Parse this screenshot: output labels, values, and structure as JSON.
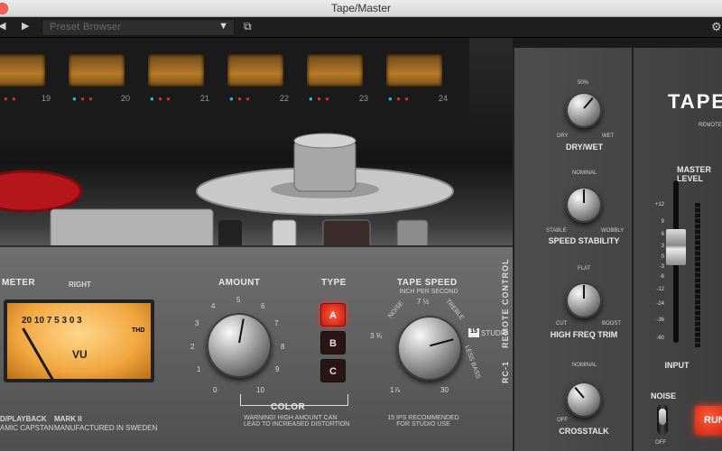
{
  "window": {
    "title": "Tape/Master"
  },
  "toolbar": {
    "preset_placeholder": "Preset Browser",
    "prev_icon": "play-reverse",
    "next_icon": "play",
    "dropdown_icon": "triangle-down",
    "window_icon": "copy-window",
    "settings_icon": "gear"
  },
  "channels": [
    "19",
    "20",
    "21",
    "22",
    "23",
    "24"
  ],
  "plugin": {
    "meter_label": "METER",
    "right_label": "RIGHT",
    "vu_scale": "20 10 7 5 3   0   3",
    "vu_text": "VU",
    "thd": "THD",
    "record_label": "D/PLAYBACK",
    "capstan_label": "AMIC CAPSTAN",
    "model": "MARK II",
    "made_in": "MANUFACTURED IN SWEDEN",
    "amount": {
      "label": "AMOUNT",
      "ticks": [
        "0",
        "1",
        "2",
        "3",
        "4",
        "5",
        "6",
        "7",
        "8",
        "9",
        "10"
      ]
    },
    "color_label": "COLOR",
    "warning": "WARNING! HIGH AMOUNT CAN\nLEAD TO INCREASED DISTORTION",
    "type": {
      "label": "TYPE",
      "options": [
        "A",
        "B",
        "C"
      ],
      "selected": "A"
    },
    "tape_speed": {
      "label": "TAPE SPEED",
      "sublabel": "INCH PER SECOND",
      "positions": [
        "3 ¾",
        "7 ½",
        "1⅞",
        "30"
      ],
      "selected": "15",
      "studio": "STUDIO",
      "noise": "NOISE",
      "treble": "TREBLE",
      "less_bass": "LESS BASS",
      "note": "15 IPS RECOMMENDED\nFOR STUDIO USE"
    }
  },
  "remote": {
    "vertical_label": "RC-1    REMOTE CONTROL",
    "logo": "TAPE",
    "logo_sub": "REMOTE",
    "dry_wet": {
      "label": "DRY/WET",
      "top": "50%",
      "min": "DRY",
      "max": "WET"
    },
    "speed_stability": {
      "label": "SPEED STABILITY",
      "top": "NOMINAL",
      "min": "STABLE",
      "max": "WOBBLY"
    },
    "high_freq_trim": {
      "label": "HIGH FREQ TRIM",
      "top": "FLAT",
      "min": "CUT",
      "max": "BOOST"
    },
    "crosstalk": {
      "label": "CROSSTALK",
      "top": "NOMINAL",
      "min": "OFF"
    },
    "master_level": {
      "label": "MASTER LEVEL",
      "scale": [
        "+12",
        "9",
        "6",
        "3",
        "0",
        "-3",
        "-6",
        "-12",
        "-24",
        "-36",
        "-60"
      ]
    },
    "input_label": "INPUT",
    "noise": {
      "label": "NOISE",
      "state": "OFF"
    },
    "run_button": "RUN"
  },
  "colors": {
    "accent_red": "#e0261a",
    "vu_amber": "#f2a63f",
    "teal_led": "#1ec7c7"
  }
}
